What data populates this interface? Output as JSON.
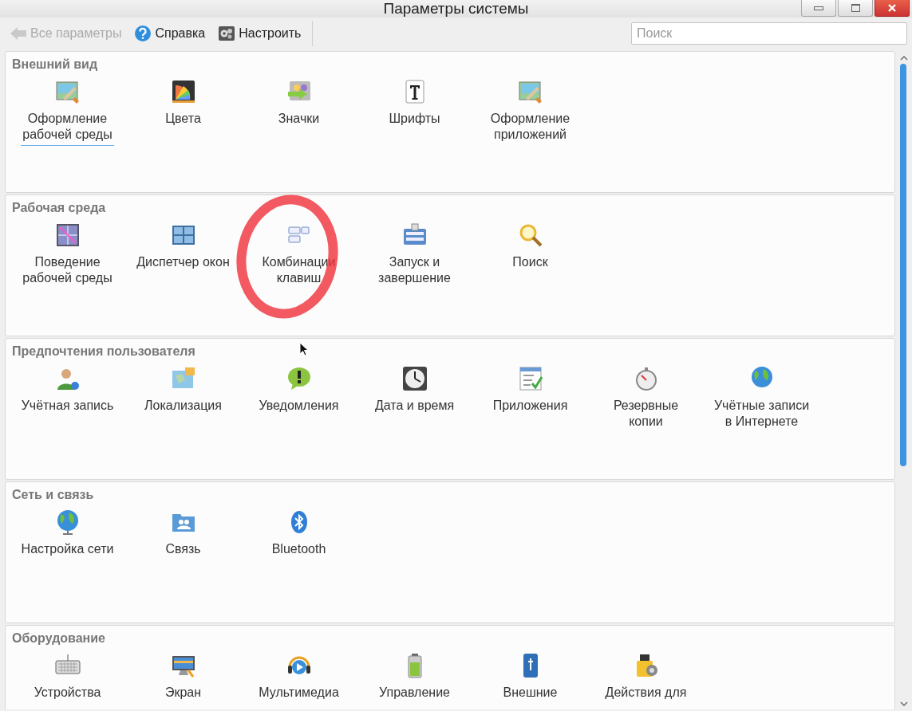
{
  "window": {
    "title": "Параметры системы"
  },
  "toolbar": {
    "back": {
      "label": "Все параметры",
      "disabled": true
    },
    "help": {
      "label": "Справка"
    },
    "configure": {
      "label": "Настроить"
    }
  },
  "search": {
    "placeholder": "Поиск"
  },
  "sections": [
    {
      "title": "Внешний вид",
      "items": [
        {
          "label": "Оформление\nрабочей среды",
          "selected": true
        },
        {
          "label": "Цвета",
          "selected": false
        },
        {
          "label": "Значки",
          "selected": false
        },
        {
          "label": "Шрифты",
          "selected": false
        },
        {
          "label": "Оформление\nприложений",
          "selected": false
        }
      ]
    },
    {
      "title": "Рабочая среда",
      "items": [
        {
          "label": "Поведение\nрабочей среды",
          "selected": false
        },
        {
          "label": "Диспетчер окон",
          "selected": false
        },
        {
          "label": "Комбинации\nклавиш",
          "selected": false
        },
        {
          "label": "Запуск и\nзавершение",
          "selected": false
        },
        {
          "label": "Поиск",
          "selected": false
        }
      ]
    },
    {
      "title": "Предпочтения пользователя",
      "items": [
        {
          "label": "Учётная запись",
          "selected": false
        },
        {
          "label": "Локализация",
          "selected": false
        },
        {
          "label": "Уведомления",
          "selected": false
        },
        {
          "label": "Дата и время",
          "selected": false
        },
        {
          "label": "Приложения",
          "selected": false
        },
        {
          "label": "Резервные\nкопии",
          "selected": false
        },
        {
          "label": "Учётные записи\nв Интернете",
          "selected": false
        }
      ]
    },
    {
      "title": "Сеть и связь",
      "items": [
        {
          "label": "Настройка сети",
          "selected": false
        },
        {
          "label": "Связь",
          "selected": false
        },
        {
          "label": "Bluetooth",
          "selected": false
        }
      ]
    },
    {
      "title": "Оборудование",
      "items": [
        {
          "label": "Устройства",
          "selected": false
        },
        {
          "label": "Экран",
          "selected": false
        },
        {
          "label": "Мультимедиа",
          "selected": false
        },
        {
          "label": "Управление",
          "selected": false
        },
        {
          "label": "Внешние",
          "selected": false
        },
        {
          "label": "Действия для",
          "selected": false
        }
      ]
    }
  ]
}
